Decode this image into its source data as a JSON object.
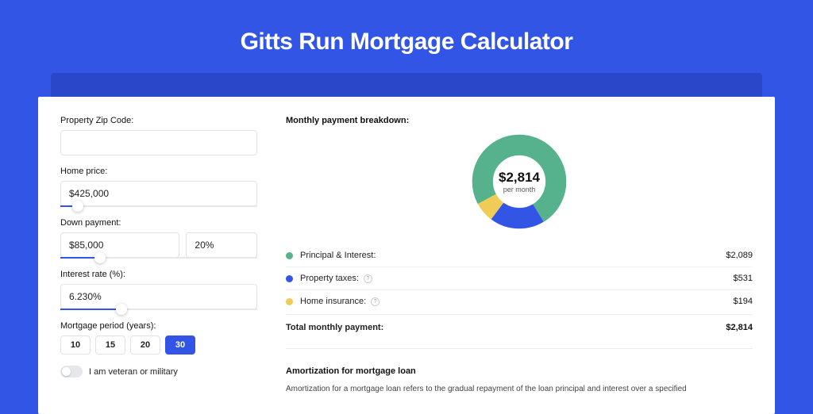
{
  "title": "Gitts Run Mortgage Calculator",
  "form": {
    "zip_label": "Property Zip Code:",
    "zip_value": "",
    "price_label": "Home price:",
    "price_value": "$425,000",
    "price_slider_pct": 9,
    "down_label": "Down payment:",
    "down_value": "$85,000",
    "down_pct_value": "20%",
    "down_slider_pct": 20,
    "rate_label": "Interest rate (%):",
    "rate_value": "6.230%",
    "rate_slider_pct": 31,
    "period_label": "Mortgage period (years):",
    "periods": [
      "10",
      "15",
      "20",
      "30"
    ],
    "period_selected": "30",
    "veteran_label": "I am veteran or military"
  },
  "breakdown": {
    "title": "Monthly payment breakdown:",
    "center_amount": "$2,814",
    "center_sub": "per month",
    "items": [
      {
        "label": "Principal & Interest:",
        "value": "$2,089",
        "color": "green",
        "help": false,
        "num": 2089
      },
      {
        "label": "Property taxes:",
        "value": "$531",
        "color": "blue",
        "help": true,
        "num": 531
      },
      {
        "label": "Home insurance:",
        "value": "$194",
        "color": "yellow",
        "help": true,
        "num": 194
      }
    ],
    "total_label": "Total monthly payment:",
    "total_value": "$2,814"
  },
  "chart_data": {
    "type": "pie",
    "title": "Monthly payment breakdown",
    "categories": [
      "Principal & Interest",
      "Property taxes",
      "Home insurance"
    ],
    "values": [
      2089,
      531,
      194
    ],
    "colors": [
      "#56b28c",
      "#3355e6",
      "#f0cc56"
    ],
    "center_label": "$2,814 per month"
  },
  "amort": {
    "title": "Amortization for mortgage loan",
    "text": "Amortization for a mortgage loan refers to the gradual repayment of the loan principal and interest over a specified"
  }
}
